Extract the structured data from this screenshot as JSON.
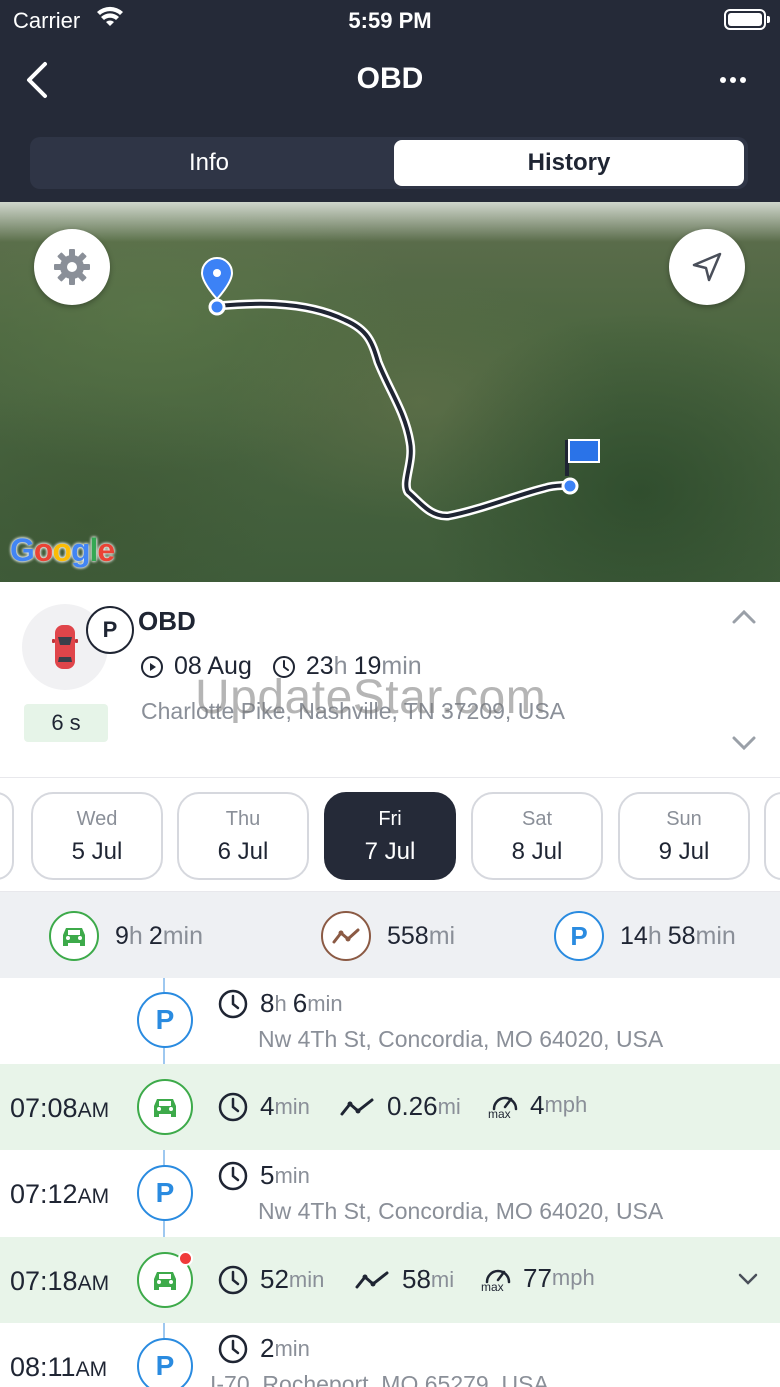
{
  "status_bar": {
    "carrier": "Carrier",
    "time": "5:59 PM"
  },
  "nav": {
    "title": "OBD",
    "tabs": {
      "info": "Info",
      "history": "History"
    },
    "active_tab": "History"
  },
  "map": {
    "logo_text": "Google"
  },
  "vehicle": {
    "name": "OBD",
    "status_badge": "P",
    "timer": "6 s",
    "start_date": "08 Aug",
    "duration_h": "23",
    "duration_h_unit": "h",
    "duration_m": "19",
    "duration_m_unit": "min",
    "address": "Charlotte Pike, Nashville, TN 37209, USA"
  },
  "watermark": "UpdateStar.com",
  "days": [
    {
      "dow": "Wed",
      "date": "5 Jul",
      "active": false
    },
    {
      "dow": "Thu",
      "date": "6 Jul",
      "active": false
    },
    {
      "dow": "Fri",
      "date": "7 Jul",
      "active": true
    },
    {
      "dow": "Sat",
      "date": "8 Jul",
      "active": false
    },
    {
      "dow": "Sun",
      "date": "9 Jul",
      "active": false
    }
  ],
  "summary": {
    "drive": {
      "h": "9",
      "h_unit": "h",
      "m": "2",
      "m_unit": "min"
    },
    "distance": {
      "value": "558",
      "unit": "mi"
    },
    "park": {
      "h": "14",
      "h_unit": "h",
      "m": "58",
      "m_unit": "min"
    }
  },
  "timeline": [
    {
      "type": "park",
      "time": "",
      "ampm": "",
      "duration": "8",
      "duration_unit": "h",
      "duration2": "6",
      "duration2_unit": "min",
      "address": "Nw 4Th St, Concordia, MO 64020, USA"
    },
    {
      "type": "drive",
      "time": "07:08",
      "ampm": "AM",
      "duration": "4",
      "duration_unit": "min",
      "distance": "0.26",
      "distance_unit": "mi",
      "max_speed": "4",
      "speed_unit": "mph",
      "max_label": "max"
    },
    {
      "type": "park",
      "time": "07:12",
      "ampm": "AM",
      "duration": "5",
      "duration_unit": "min",
      "address": "Nw 4Th St, Concordia, MO 64020, USA"
    },
    {
      "type": "drive",
      "time": "07:18",
      "ampm": "AM",
      "duration": "52",
      "duration_unit": "min",
      "distance": "58",
      "distance_unit": "mi",
      "max_speed": "77",
      "speed_unit": "mph",
      "max_label": "max"
    },
    {
      "type": "park",
      "time": "08:11",
      "ampm": "AM",
      "duration": "2",
      "duration_unit": "min",
      "address": "I-70, Rocheport, MO 65279, USA"
    }
  ],
  "colors": {
    "header": "#252a38",
    "drive_green": "#3daa4a",
    "park_blue": "#2a8be0",
    "distance_brown": "#8b5a44",
    "alert_red": "#f03a3a"
  },
  "icons": [
    "back-arrow-icon",
    "more-dots-icon",
    "gear-icon",
    "navigation-arrow-icon",
    "start-pin-icon",
    "finish-flag-icon",
    "car-icon",
    "play-circle-icon",
    "clock-icon",
    "chevron-up-icon",
    "chevron-down-icon",
    "route-icon",
    "parking-icon",
    "speedometer-icon"
  ]
}
